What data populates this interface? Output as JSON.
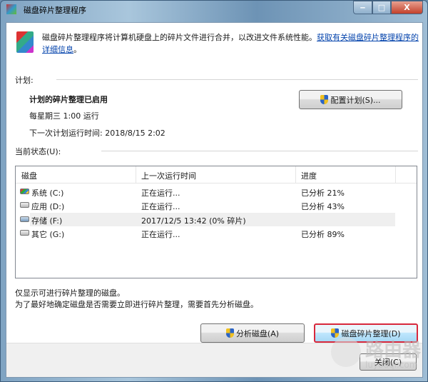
{
  "window": {
    "title": "磁盘碎片整理程序",
    "minimize": "‒",
    "maximize": "□",
    "close": "X"
  },
  "description": {
    "text": "磁盘碎片整理程序将计算机硬盘上的碎片文件进行合并，以改进文件系统性能。",
    "link": "获取有关磁盘碎片整理程序的详细信息",
    "end": "。"
  },
  "schedule": {
    "section": "计划:",
    "status": "计划的碎片整理已启用",
    "frequency": "每星期三  1:00 运行",
    "next_run": "下一次计划运行时间: 2018/8/15 2:02",
    "configure_button": "配置计划(S)..."
  },
  "current": {
    "section": "当前状态(U):",
    "columns": [
      "磁盘",
      "上一次运行时间",
      "进度"
    ],
    "rows": [
      {
        "disk": "系统 (C:)",
        "last_run": "正在运行...",
        "progress": "已分析 21%",
        "icon": "system-drive-icon"
      },
      {
        "disk": "应用 (D:)",
        "last_run": "正在运行...",
        "progress": "已分析 43%",
        "icon": "drive-icon"
      },
      {
        "disk": "存储 (F:)",
        "last_run": "2017/12/5 13:42 (0% 碎片)",
        "progress": "",
        "icon": "drive-icon"
      },
      {
        "disk": "其它 (G:)",
        "last_run": "正在运行...",
        "progress": "已分析 89%",
        "icon": "drive-icon"
      }
    ]
  },
  "notes": [
    "仅显示可进行碎片整理的磁盘。",
    "为了最好地确定磁盘是否需要立即进行碎片整理，需要首先分析磁盘。"
  ],
  "buttons": {
    "analyze": "分析磁盘(A)",
    "defrag": "磁盘碎片整理(D)",
    "close": "关闭(C)"
  },
  "watermark": {
    "text": "路由器",
    "sub": "luyouqi.com"
  }
}
